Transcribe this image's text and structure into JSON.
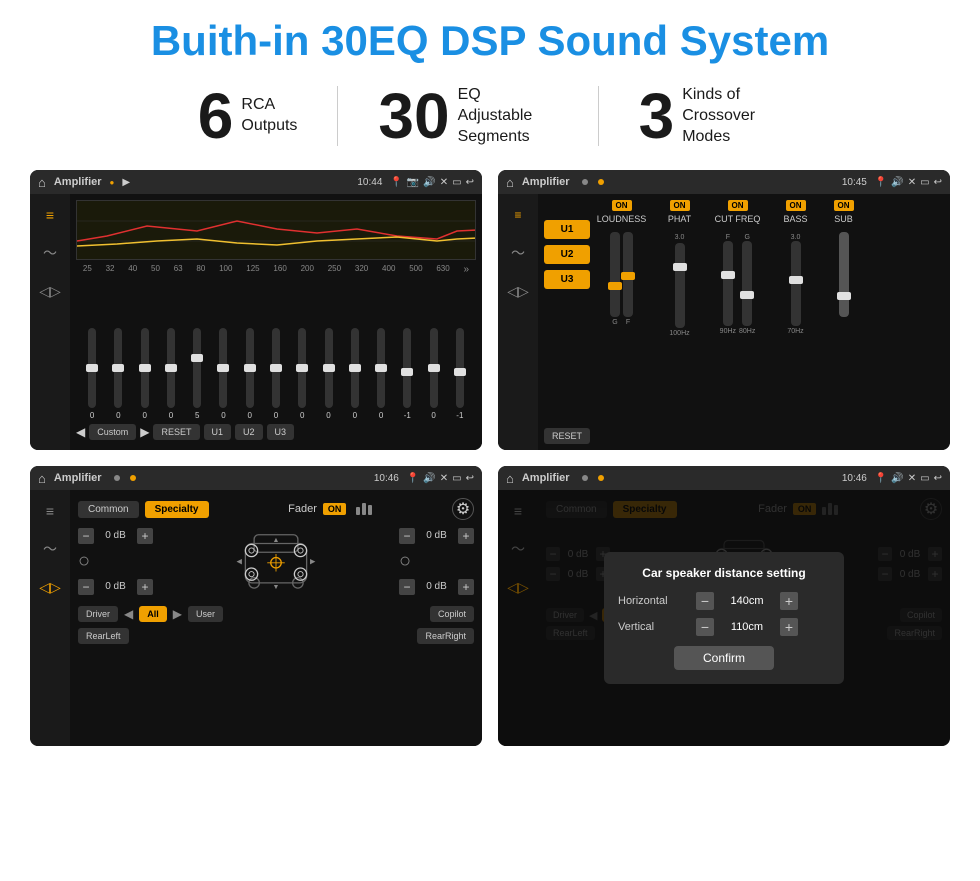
{
  "title": "Buith-in 30EQ DSP Sound System",
  "stats": [
    {
      "number": "6",
      "text": "RCA\nOutputs"
    },
    {
      "number": "30",
      "text": "EQ Adjustable\nSegments"
    },
    {
      "number": "3",
      "text": "Kinds of\nCrossover Modes"
    }
  ],
  "screens": {
    "screen1": {
      "header": {
        "title": "Amplifier",
        "time": "10:44"
      },
      "eq_labels": [
        "25",
        "32",
        "40",
        "50",
        "63",
        "80",
        "100",
        "125",
        "160",
        "200",
        "250",
        "320",
        "400",
        "500",
        "630"
      ],
      "eq_values": [
        "0",
        "0",
        "0",
        "0",
        "5",
        "0",
        "0",
        "0",
        "0",
        "0",
        "0",
        "0",
        "-1",
        "0",
        "-1"
      ],
      "buttons": [
        "Custom",
        "RESET",
        "U1",
        "U2",
        "U3"
      ]
    },
    "screen2": {
      "header": {
        "title": "Amplifier",
        "time": "10:45"
      },
      "u_buttons": [
        "U1",
        "U2",
        "U3"
      ],
      "channels": [
        "LOUDNESS",
        "PHAT",
        "CUT FREQ",
        "BASS",
        "SUB"
      ],
      "reset_label": "RESET"
    },
    "screen3": {
      "header": {
        "title": "Amplifier",
        "time": "10:46"
      },
      "tabs": [
        "Common",
        "Specialty"
      ],
      "fader_label": "Fader",
      "on_label": "ON",
      "db_values": [
        "0 dB",
        "0 dB",
        "0 dB",
        "0 dB"
      ],
      "buttons": [
        "Driver",
        "All",
        "RearLeft",
        "User",
        "RearRight",
        "Copilot"
      ]
    },
    "screen4": {
      "header": {
        "title": "Amplifier",
        "time": "10:46"
      },
      "tabs": [
        "Common",
        "Specialty"
      ],
      "on_label": "ON",
      "dialog": {
        "title": "Car speaker distance setting",
        "horizontal_label": "Horizontal",
        "horizontal_value": "140cm",
        "vertical_label": "Vertical",
        "vertical_value": "110cm",
        "confirm_label": "Confirm"
      },
      "buttons": [
        "Driver",
        "RearLeft",
        "All",
        "User",
        "RearRight",
        "Copilot"
      ],
      "db_values": [
        "0 dB",
        "0 dB"
      ]
    }
  }
}
